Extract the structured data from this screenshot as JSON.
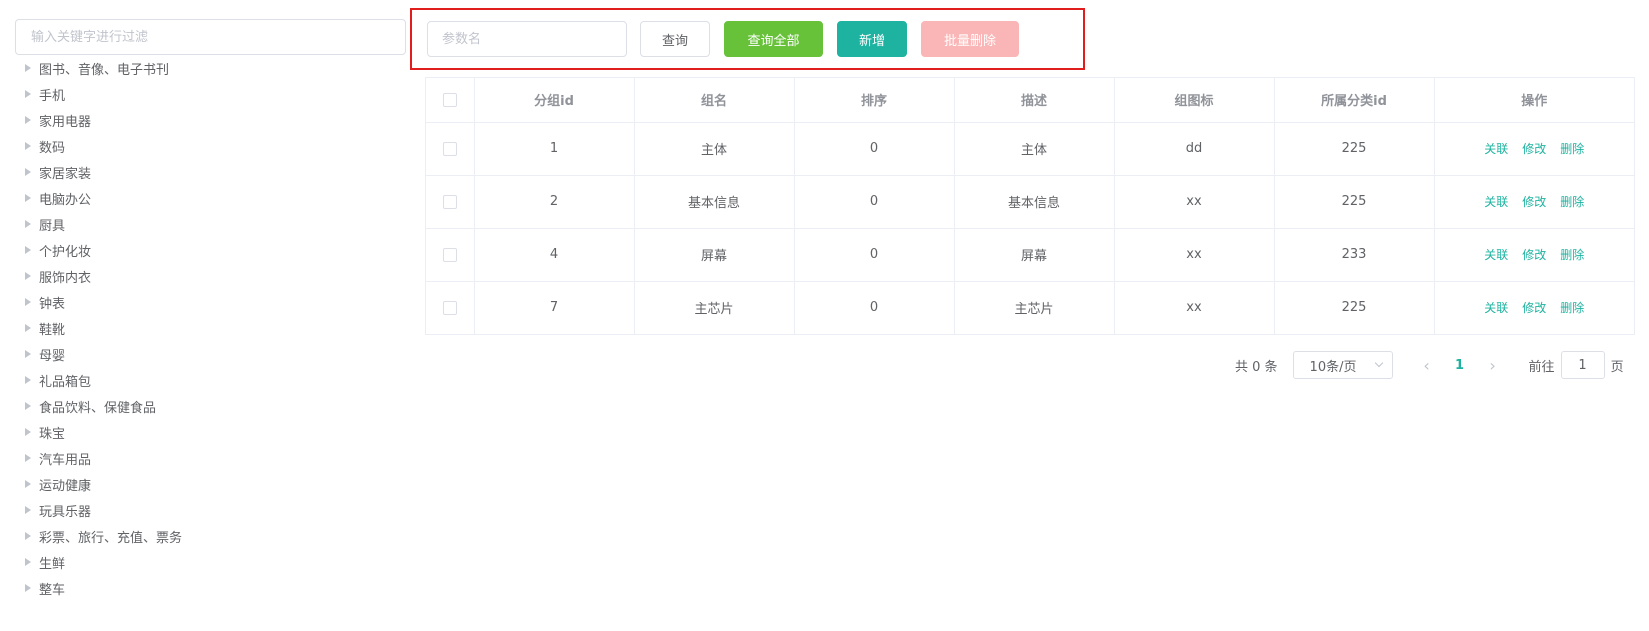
{
  "tree": {
    "filter_placeholder": "输入关键字进行过滤",
    "nodes": [
      "图书、音像、电子书刊",
      "手机",
      "家用电器",
      "数码",
      "家居家装",
      "电脑办公",
      "厨具",
      "个护化妆",
      "服饰内衣",
      "钟表",
      "鞋靴",
      "母婴",
      "礼品箱包",
      "食品饮料、保健食品",
      "珠宝",
      "汽车用品",
      "运动健康",
      "玩具乐器",
      "彩票、旅行、充值、票务",
      "生鲜",
      "整车"
    ]
  },
  "toolbar": {
    "param_placeholder": "参数名",
    "query_label": "查询",
    "query_all_label": "查询全部",
    "add_label": "新增",
    "batch_delete_label": "批量删除"
  },
  "table": {
    "headers": [
      "分组id",
      "组名",
      "排序",
      "描述",
      "组图标",
      "所属分类id",
      "操作"
    ],
    "rows": [
      {
        "id": "1",
        "name": "主体",
        "sort": "0",
        "desc": "主体",
        "icon": "dd",
        "catelog": "225"
      },
      {
        "id": "2",
        "name": "基本信息",
        "sort": "0",
        "desc": "基本信息",
        "icon": "xx",
        "catelog": "225"
      },
      {
        "id": "4",
        "name": "屏幕",
        "sort": "0",
        "desc": "屏幕",
        "icon": "xx",
        "catelog": "233"
      },
      {
        "id": "7",
        "name": "主芯片",
        "sort": "0",
        "desc": "主芯片",
        "icon": "xx",
        "catelog": "225"
      }
    ],
    "ops": {
      "relate": "关联",
      "edit": "修改",
      "delete": "删除"
    }
  },
  "pagination": {
    "total_text": "共 0 条",
    "page_size": "10条/页",
    "current_page": "1",
    "goto_prefix": "前往",
    "goto_value": "1",
    "goto_suffix": "页"
  },
  "colors": {
    "accent": "#1db3a0",
    "success": "#67c23a",
    "danger_disabled": "#fab6b6",
    "highlight_border": "#e01e1e"
  }
}
